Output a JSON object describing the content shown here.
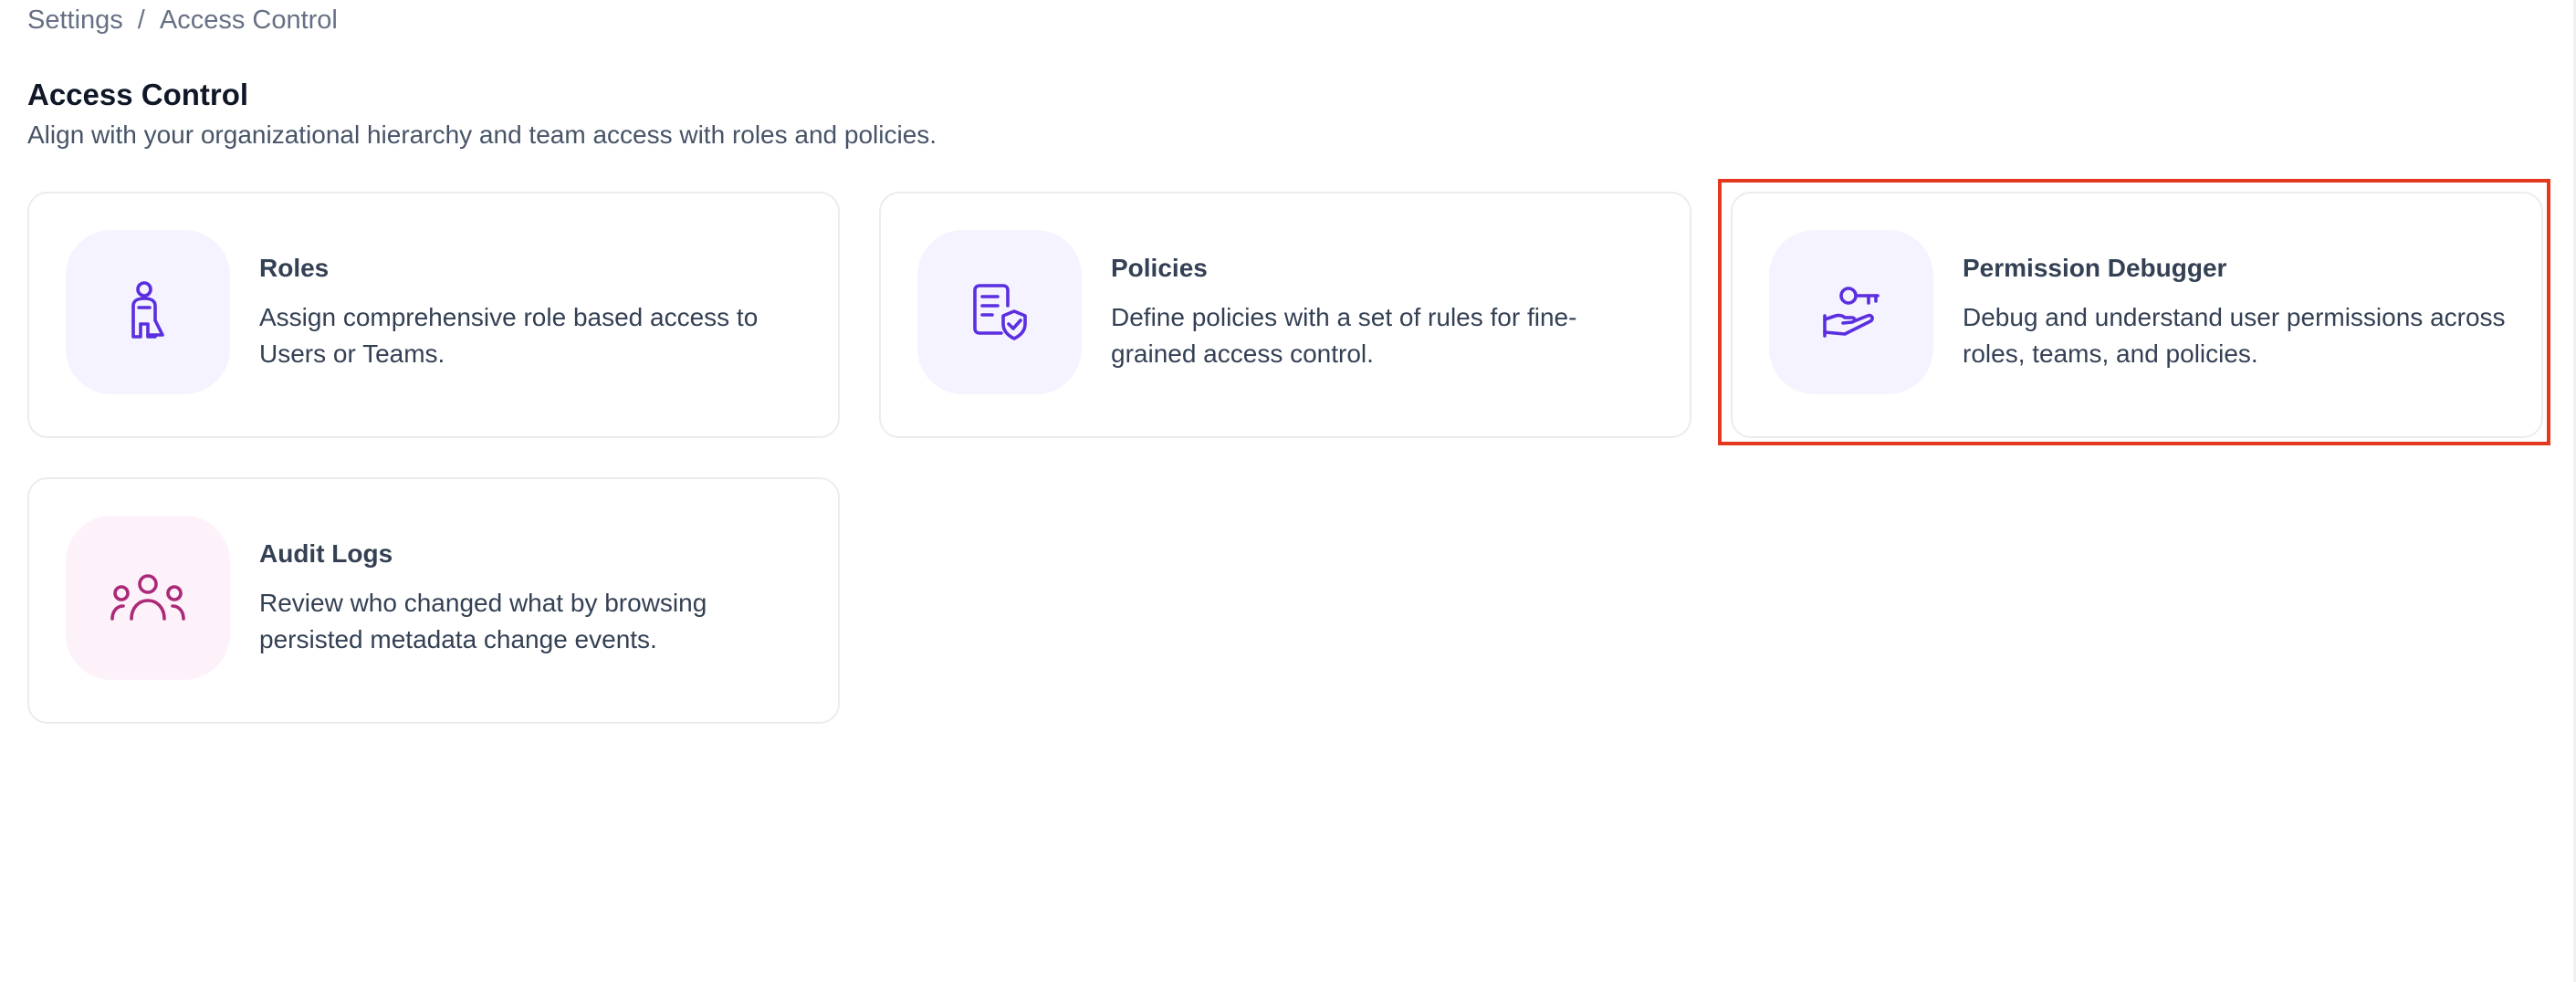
{
  "breadcrumb": {
    "items": [
      "Settings",
      "Access Control"
    ],
    "separator": "/"
  },
  "header": {
    "title": "Access Control",
    "subtitle": "Align with your organizational hierarchy and team access with roles and policies."
  },
  "cards": [
    {
      "title": "Roles",
      "description": "Assign comprehensive role based access to Users or Teams.",
      "icon": "person-role-icon",
      "accent": "#5b2ee0",
      "tile": "#f4f3ff"
    },
    {
      "title": "Policies",
      "description": "Define policies with a set of rules for fine-grained access control.",
      "icon": "document-shield-icon",
      "accent": "#5b2ee0",
      "tile": "#f4f3ff"
    },
    {
      "title": "Permission Debugger",
      "description": "Debug and understand user permissions across roles, teams, and policies.",
      "icon": "hand-key-icon",
      "accent": "#5b2ee0",
      "tile": "#f4f3ff"
    },
    {
      "title": "Audit Logs",
      "description": "Review who changed what by browsing persisted metadata change events.",
      "icon": "people-group-icon",
      "accent": "#ab2a78",
      "tile": "#fdf2fa"
    }
  ],
  "colors": {
    "highlight": "#e5391f",
    "border": "#eaecf0"
  }
}
